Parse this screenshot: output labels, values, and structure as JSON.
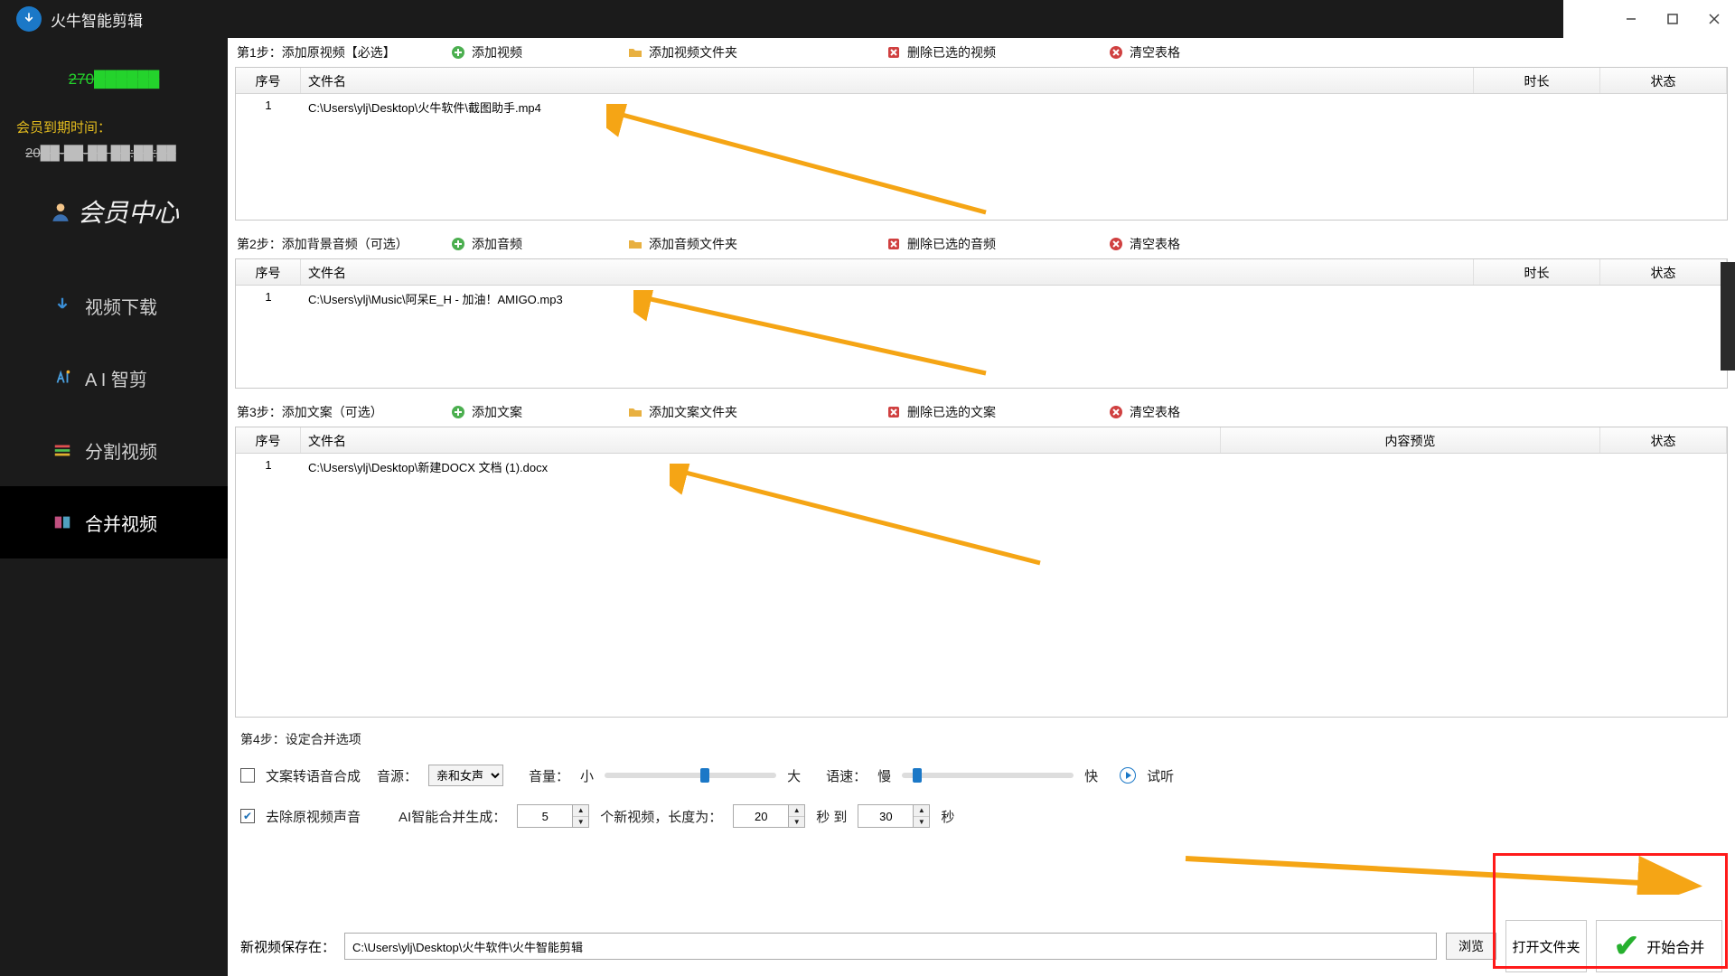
{
  "app": {
    "title": "火牛智能剪辑"
  },
  "winbtns": {
    "min": "minimize",
    "max": "maximize",
    "close": "close"
  },
  "sidebar": {
    "user_id": "270██████",
    "expire_label": "会员到期时间：",
    "expire_date": "20██-██-██ ██:██:██",
    "member_center": "会员中心",
    "items": [
      {
        "label": "视频下载",
        "icon": "download-icon"
      },
      {
        "label": "A I 智剪",
        "icon": "ai-icon"
      },
      {
        "label": "分割视频",
        "icon": "split-icon"
      },
      {
        "label": "合并视频",
        "icon": "merge-icon",
        "active": true
      }
    ]
  },
  "step1": {
    "title": "第1步：添加原视频【必选】",
    "add": "添加视频",
    "add_folder": "添加视频文件夹",
    "delete": "删除已选的视频",
    "clear": "清空表格",
    "cols": {
      "idx": "序号",
      "name": "文件名",
      "dur": "时长",
      "stat": "状态"
    },
    "rows": [
      {
        "idx": "1",
        "name": "C:\\Users\\ylj\\Desktop\\火牛软件\\截图助手.mp4"
      }
    ]
  },
  "step2": {
    "title": "第2步：添加背景音频（可选）",
    "add": "添加音频",
    "add_folder": "添加音频文件夹",
    "delete": "删除已选的音频",
    "clear": "清空表格",
    "cols": {
      "idx": "序号",
      "name": "文件名",
      "dur": "时长",
      "stat": "状态"
    },
    "rows": [
      {
        "idx": "1",
        "name": "C:\\Users\\ylj\\Music\\阿呆E_H - 加油！AMIGO.mp3"
      }
    ]
  },
  "step3": {
    "title": "第3步：添加文案（可选）",
    "add": "添加文案",
    "add_folder": "添加文案文件夹",
    "delete": "删除已选的文案",
    "clear": "清空表格",
    "cols": {
      "idx": "序号",
      "name": "文件名",
      "preview": "内容预览",
      "stat": "状态"
    },
    "rows": [
      {
        "idx": "1",
        "name": "C:\\Users\\ylj\\Desktop\\新建DOCX 文档 (1).docx"
      }
    ]
  },
  "step4": {
    "title": "第4步：设定合并选项",
    "tts_checkbox_label": "文案转语音合成",
    "source_label": "音源：",
    "source_value": "亲和女声",
    "volume_label": "音量：",
    "volume_low": "小",
    "volume_high": "大",
    "speed_label": "语速：",
    "speed_low": "慢",
    "speed_high": "快",
    "preview": "试听",
    "remove_audio_label": "去除原视频声音",
    "ai_gen_label": "AI智能合并生成：",
    "ai_count": "5",
    "ai_count_suffix": "个新视频，长度为：",
    "len_from": "20",
    "len_mid": "秒 到",
    "len_to": "30",
    "len_suffix": "秒"
  },
  "bottom": {
    "save_label": "新视频保存在：",
    "save_path": "C:\\Users\\ylj\\Desktop\\火牛软件\\火牛智能剪辑",
    "browse": "浏览",
    "open_folder": "打开文件夹",
    "start": "开始合并"
  }
}
